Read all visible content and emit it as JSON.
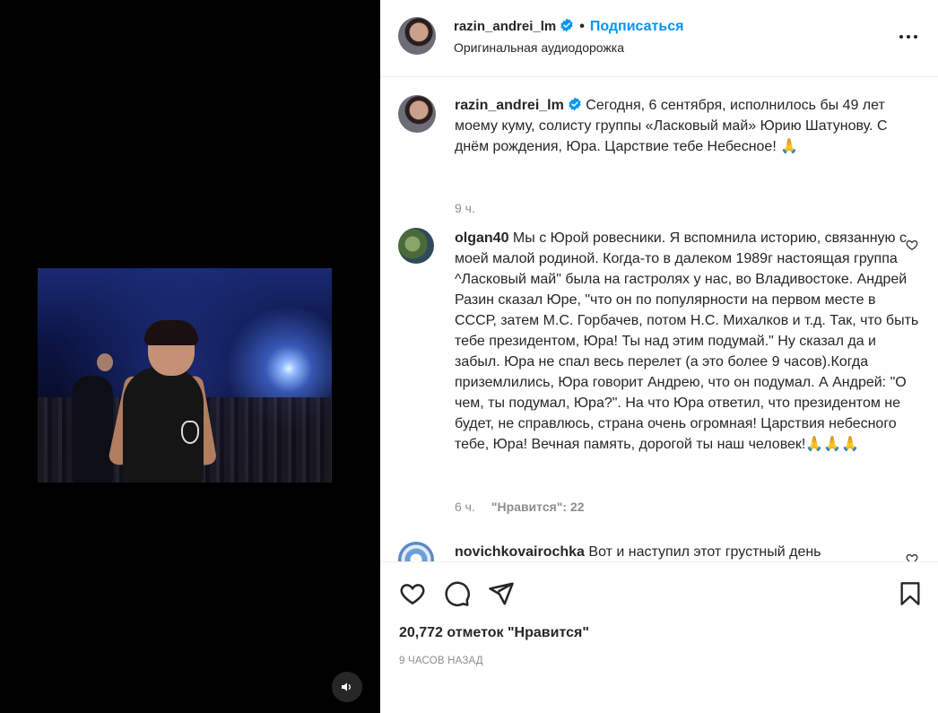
{
  "post": {
    "username": "razin_andrei_lm",
    "follow_label": "Подписаться",
    "dot": "•",
    "audio_label": "Оригинальная аудиодорожка"
  },
  "caption": {
    "username": "razin_andrei_lm",
    "text": "Сегодня, 6 сентября, исполнилось бы 49 лет моему куму, солисту группы «Ласковый май» Юрию Шатунову. С днём рождения, Юра. Царствие тебе Небесное! 🙏",
    "time": "9 ч."
  },
  "comments": [
    {
      "username": "olgan40",
      "text": "Мы с Юрой ровесники. Я вспомнила историю, связанную с моей малой родиной. Когда-то в далеком 1989г настоящая группа ^Ласковый май\" была на гастролях у нас, во Владивостоке. Андрей Разин сказал Юре, \"что он по популярности на первом месте в СССР, затем М.С. Горбачев, потом Н.С. Михалков и т.д. Так, что быть тебе президентом, Юра! Ты над этим подумай.\" Ну сказал да и забыл. Юра не спал весь перелет (а это более 9 часов).Когда приземлились, Юра говорит Андрею, что он подумал. А Андрей: \"О чем, ты подумал, Юра?\". На что Юра ответил, что президентом не будет, не справлюсь, страна очень огромная! Царствия небесного тебе, Юра! Вечная память, дорогой ты наш человек!🙏🙏🙏",
      "time": "6 ч.",
      "likes": "\"Нравится\": 22"
    },
    {
      "username": "novichkovairochka",
      "text": "Вот и наступил этот грустный день"
    }
  ],
  "footer": {
    "likes_count": "20,772 отметок \"Нравится\"",
    "posted_ago": "9 ЧАСОВ НАЗАД"
  },
  "colors": {
    "accent": "#0095f6",
    "verified": "#0095f6",
    "muted": "#8e8e8e",
    "text": "#262626"
  }
}
